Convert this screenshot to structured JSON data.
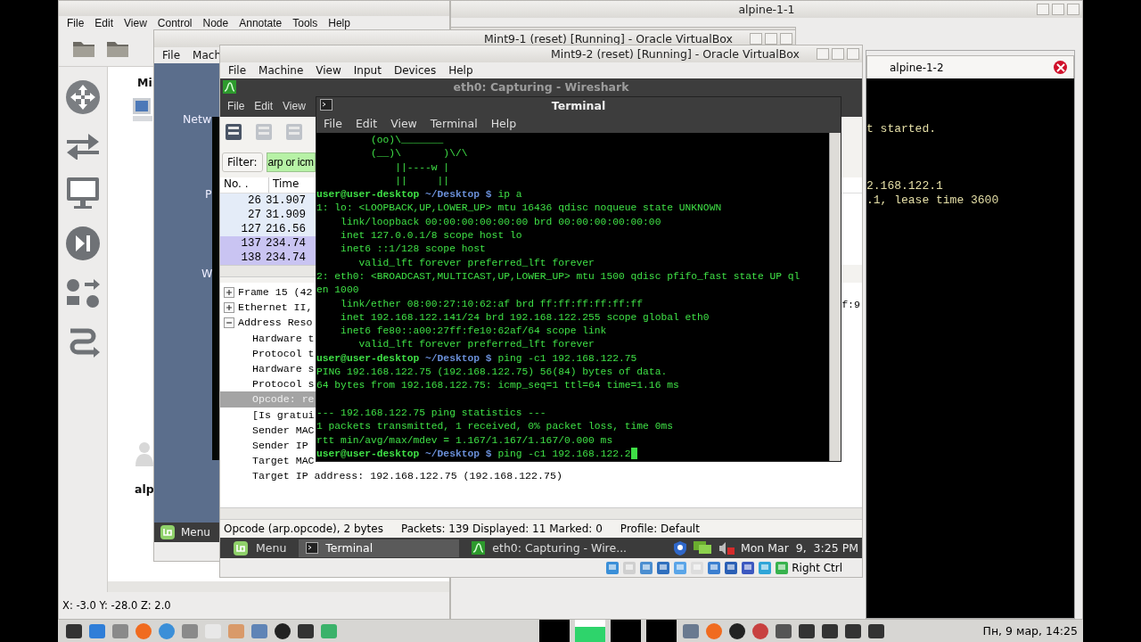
{
  "gns3": {
    "menu": [
      "File",
      "Edit",
      "View",
      "Control",
      "Node",
      "Annotate",
      "Tools",
      "Help"
    ],
    "nodes": [
      {
        "label": "Mi"
      },
      {
        "label": "alp"
      }
    ],
    "status": "X: -3.0 Y: -28.0 Z: 2.0"
  },
  "alpine": {
    "title": "alpine-1-1",
    "tabs": [
      {
        "label": "alpine-1-2",
        "selected": true
      }
    ],
    "blocks": [
      [
        "t started."
      ],
      [
        "2.168.122.1",
        ".1, lease time 3600"
      ]
    ]
  },
  "mint1": {
    "title": "Mint9-1 (reset) [Running] - Oracle VirtualBox",
    "menu": [
      "File",
      "Mach"
    ],
    "desktop_icons": [
      "Netw",
      "P",
      "W"
    ],
    "taskbar_menu": "Menu"
  },
  "mint2": {
    "title": "Mint9-2 (reset) [Running] - Oracle VirtualBox",
    "menu": [
      "File",
      "Machine",
      "View",
      "Input",
      "Devices",
      "Help"
    ],
    "wireshark": {
      "title": "eth0: Capturing - Wireshark",
      "menu": [
        "File",
        "Edit",
        "View"
      ],
      "filter_label": "Filter:",
      "filter_value": "arp or icm",
      "columns": [
        "No. .",
        "Time"
      ],
      "rows": [
        {
          "no": "26",
          "time": "31.907",
          "color": "#e4ecf8"
        },
        {
          "no": "27",
          "time": "31.909",
          "color": "#e4ecf8"
        },
        {
          "no": "127",
          "time": "216.56",
          "color": "#e4ecf8"
        },
        {
          "no": "137",
          "time": "234.74",
          "color": "#c9c4f2"
        },
        {
          "no": "138",
          "time": "234.74",
          "color": "#c9c4f2"
        }
      ],
      "details": [
        {
          "label": "Frame 15 (42",
          "expanded": false,
          "selected": false
        },
        {
          "label": "Ethernet II,",
          "expanded": false,
          "selected": false
        },
        {
          "label": "Address Reso",
          "expanded": true,
          "selected": false,
          "children": [
            {
              "label": "Hardware t",
              "selected": false
            },
            {
              "label": "Protocol t",
              "selected": false
            },
            {
              "label": "Hardware s",
              "selected": false
            },
            {
              "label": "Protocol s",
              "selected": false
            },
            {
              "label": "Opcode: re",
              "selected": true
            },
            {
              "label": "[Is gratui",
              "selected": false
            },
            {
              "label": "Sender MAC",
              "selected": false
            },
            {
              "label": "Sender IP",
              "selected": false
            },
            {
              "label": "Target MAC",
              "selected": false
            },
            {
              "label": "Target IP address: 192.168.122.75 (192.168.122.75)",
              "selected": false
            }
          ]
        }
      ],
      "detail_tail": "f:9",
      "status": [
        "Opcode (arp.opcode), 2 bytes",
        "Packets: 139 Displayed: 11 Marked: 0",
        "Profile: Default"
      ]
    },
    "terminal": {
      "title": "Terminal",
      "menu": [
        "File",
        "Edit",
        "View",
        "Terminal",
        "Help"
      ],
      "lines": [
        {
          "kind": "output",
          "text": "         (oo)\\_______"
        },
        {
          "kind": "output",
          "text": "         (__)\\       )\\/\\"
        },
        {
          "kind": "output",
          "text": "             ||----w |"
        },
        {
          "kind": "output",
          "text": "             ||     ||"
        },
        {
          "kind": "prompt",
          "user": "user@user-desktop",
          "path": "~/Desktop $",
          "command": "ip a",
          "cursor": false
        },
        {
          "kind": "output",
          "text": "1: lo: <LOOPBACK,UP,LOWER_UP> mtu 16436 qdisc noqueue state UNKNOWN"
        },
        {
          "kind": "output",
          "text": "    link/loopback 00:00:00:00:00:00 brd 00:00:00:00:00:00"
        },
        {
          "kind": "output",
          "text": "    inet 127.0.0.1/8 scope host lo"
        },
        {
          "kind": "output",
          "text": "    inet6 ::1/128 scope host"
        },
        {
          "kind": "output",
          "text": "       valid_lft forever preferred_lft forever"
        },
        {
          "kind": "output",
          "text": "2: eth0: <BROADCAST,MULTICAST,UP,LOWER_UP> mtu 1500 qdisc pfifo_fast state UP ql"
        },
        {
          "kind": "output",
          "text": "en 1000"
        },
        {
          "kind": "output",
          "text": "    link/ether 08:00:27:10:62:af brd ff:ff:ff:ff:ff:ff"
        },
        {
          "kind": "output",
          "text": "    inet 192.168.122.141/24 brd 192.168.122.255 scope global eth0"
        },
        {
          "kind": "output",
          "text": "    inet6 fe80::a00:27ff:fe10:62af/64 scope link"
        },
        {
          "kind": "output",
          "text": "       valid_lft forever preferred_lft forever"
        },
        {
          "kind": "prompt",
          "user": "user@user-desktop",
          "path": "~/Desktop $",
          "command": "ping -c1 192.168.122.75",
          "cursor": false
        },
        {
          "kind": "output",
          "text": "PING 192.168.122.75 (192.168.122.75) 56(84) bytes of data."
        },
        {
          "kind": "output",
          "text": "64 bytes from 192.168.122.75: icmp_seq=1 ttl=64 time=1.16 ms"
        },
        {
          "kind": "blank"
        },
        {
          "kind": "output",
          "text": "--- 192.168.122.75 ping statistics ---"
        },
        {
          "kind": "output",
          "text": "1 packets transmitted, 1 received, 0% packet loss, time 0ms"
        },
        {
          "kind": "output",
          "text": "rtt min/avg/max/mdev = 1.167/1.167/1.167/0.000 ms"
        },
        {
          "kind": "prompt",
          "user": "user@user-desktop",
          "path": "~/Desktop $",
          "command": "ping -c1 192.168.122.2",
          "cursor": true
        }
      ]
    },
    "taskbar": {
      "menu": "Menu",
      "tasks": [
        {
          "label": "Terminal",
          "selected": true
        },
        {
          "label": "eth0: Capturing - Wire...",
          "selected": false
        }
      ],
      "clock": "Mon Mar  9,  3:25 PM"
    },
    "host_key": "Right Ctrl"
  },
  "host_taskbar": {
    "clock": "Пн, 9 мар, 14:25"
  }
}
